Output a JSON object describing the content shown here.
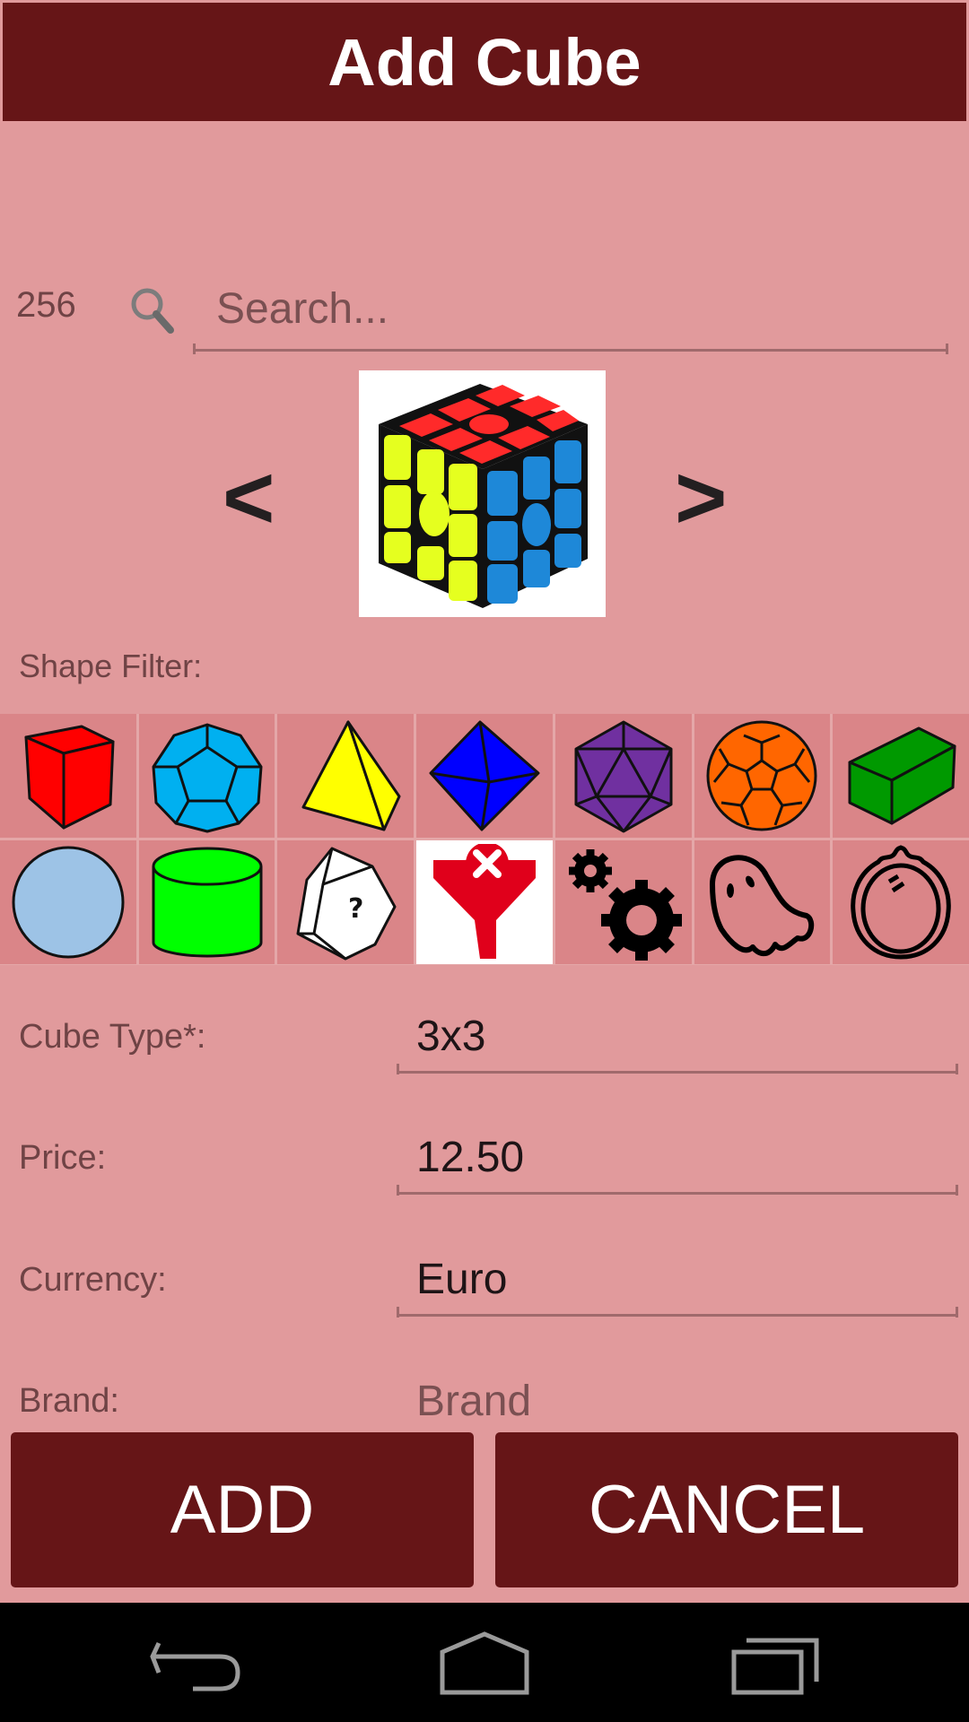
{
  "header": {
    "title": "Add Cube"
  },
  "search": {
    "count": "256",
    "placeholder": "Search...",
    "value": "",
    "icon": "search-icon"
  },
  "carousel": {
    "prev_label": "<",
    "next_label": ">",
    "image": "rubiks-cube-3x3-image"
  },
  "shape_filter": {
    "label": "Shape Filter:",
    "items": [
      {
        "name": "cube",
        "color": "#FF0000"
      },
      {
        "name": "dodecahedron",
        "color": "#00B0F0"
      },
      {
        "name": "tetrahedron",
        "color": "#FFFF00"
      },
      {
        "name": "octahedron",
        "color": "#0000FF"
      },
      {
        "name": "icosahedron",
        "color": "#7030A0"
      },
      {
        "name": "truncated-icosahedron",
        "color": "#FF6600"
      },
      {
        "name": "cuboid",
        "color": "#009900"
      },
      {
        "name": "sphere",
        "color": "#9DC3E6"
      },
      {
        "name": "cylinder",
        "color": "#00FF00"
      },
      {
        "name": "unknown-shape",
        "color": "#FFFFFF"
      },
      {
        "name": "clear-filter",
        "color": "#E0001B",
        "selected": true
      },
      {
        "name": "gears",
        "color": "#000000"
      },
      {
        "name": "ghost",
        "color": "#000000"
      },
      {
        "name": "mirror",
        "color": "#000000"
      }
    ]
  },
  "form": {
    "cube_type": {
      "label": "Cube Type*:",
      "value": "3x3"
    },
    "price": {
      "label": "Price:",
      "value": "12.50"
    },
    "currency": {
      "label": "Currency:",
      "value": "Euro"
    },
    "brand": {
      "label": "Brand:",
      "placeholder": "Brand",
      "value": ""
    }
  },
  "actions": {
    "add_label": "ADD",
    "cancel_label": "CANCEL"
  },
  "colors": {
    "header": "#661517",
    "background": "#E19A9C",
    "tile": "#DA8588",
    "button": "#661517"
  },
  "navbar": {
    "back": "back-icon",
    "home": "home-icon",
    "recents": "recents-icon"
  }
}
